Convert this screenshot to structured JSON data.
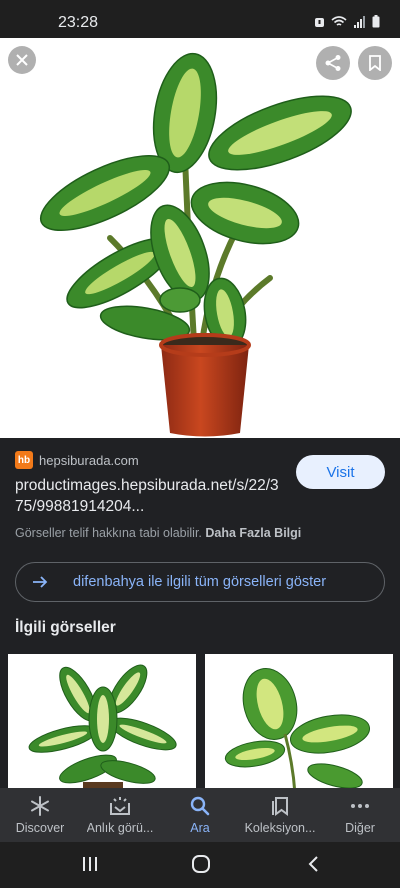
{
  "status_bar": {
    "time": "23:28"
  },
  "viewer": {
    "close_icon": "close-icon",
    "share_icon": "share-icon",
    "save_icon": "bookmark-icon"
  },
  "source": {
    "logo_text": "hb",
    "name": "hepsiburada.com",
    "url": "productimages.hepsiburada.net/s/22/375/99881914204...",
    "visit_label": "Visit",
    "copyright_text": "Görseller telif hakkına tabi olabilir.",
    "more_info": "Daha Fazla Bilgi"
  },
  "all_images": {
    "label": "difenbahya ile ilgili tüm görselleri göster"
  },
  "related": {
    "title": "İlgili görseller"
  },
  "bottom_nav": {
    "items": [
      {
        "label": "Discover",
        "icon": "asterisk-icon"
      },
      {
        "label": "Anlık görü...",
        "icon": "snapshot-icon"
      },
      {
        "label": "Ara",
        "icon": "search-icon"
      },
      {
        "label": "Koleksiyon...",
        "icon": "collections-icon"
      },
      {
        "label": "Diğer",
        "icon": "more-icon"
      }
    ]
  },
  "colors": {
    "background": "#202124",
    "accent": "#8ab4f8",
    "visit_bg": "#e8f0fe",
    "brand_hb": "#f27a1a"
  }
}
